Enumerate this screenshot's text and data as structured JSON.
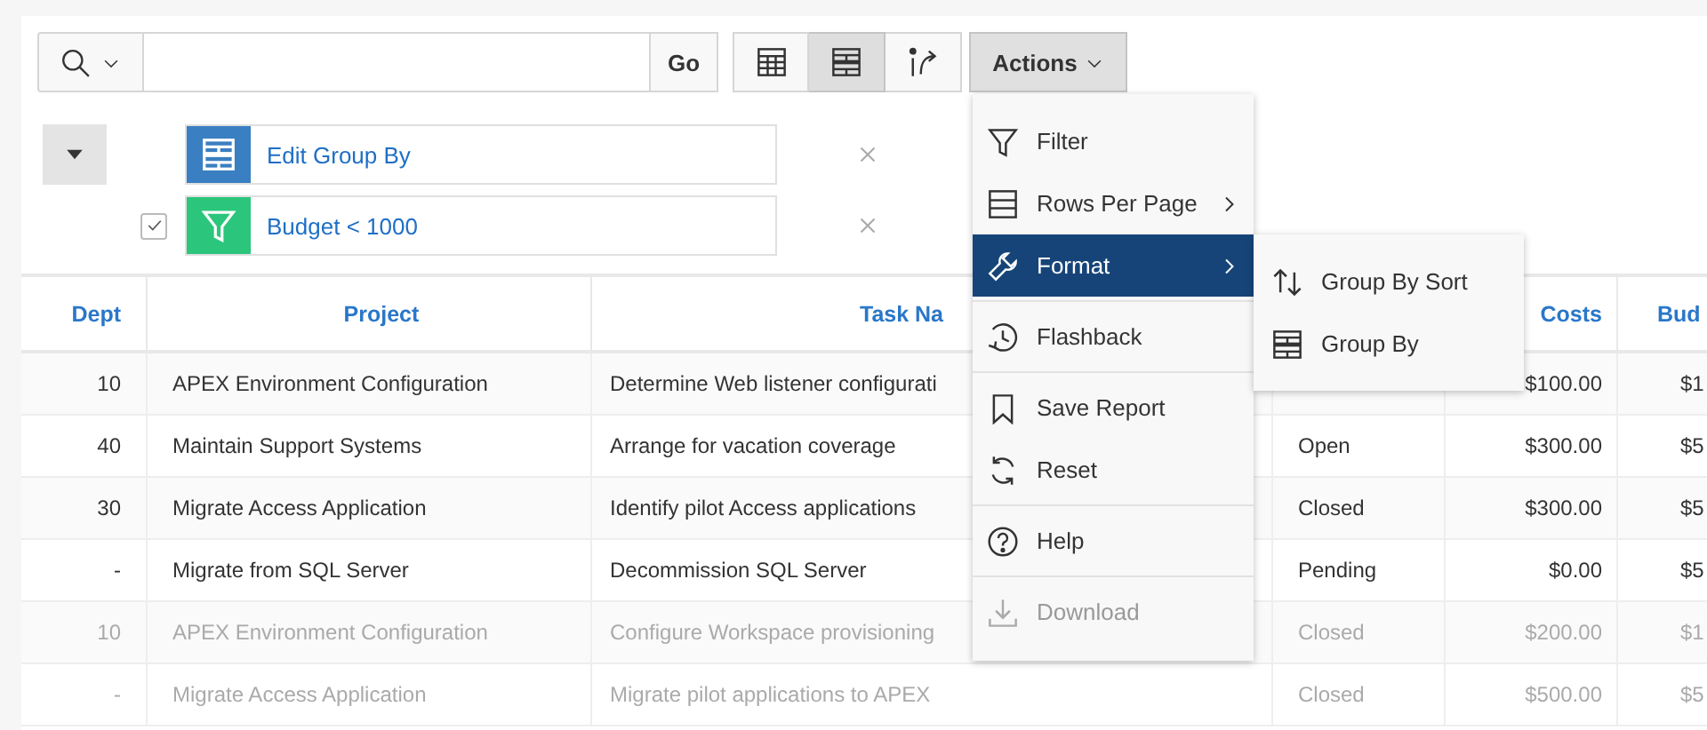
{
  "toolbar": {
    "go_button": "Go",
    "views": [
      {
        "selected": false
      },
      {
        "selected": true
      },
      {
        "selected": false
      }
    ],
    "actions_button": {
      "label": "Actions",
      "expanded": true
    }
  },
  "report_settings": {
    "expanded": true,
    "items": [
      {
        "kind": "group_by",
        "label": "Edit Group By"
      },
      {
        "kind": "filter",
        "label": "Budget < 1000",
        "checked": true
      }
    ]
  },
  "table": {
    "columns": [
      {
        "label": "Dept"
      },
      {
        "label": "Project"
      },
      {
        "label": "Task Na"
      },
      {},
      {
        "label": "Costs"
      },
      {
        "label": "Bud"
      }
    ],
    "rows": [
      {
        "faded": false,
        "cells": [
          "10",
          "APEX Environment Configuration",
          "Determine Web listener configurati",
          null,
          "$100.00",
          "$1"
        ]
      },
      {
        "faded": false,
        "cells": [
          "40",
          "Maintain Support Systems",
          "Arrange for vacation coverage",
          "Open",
          "$300.00",
          "$5"
        ]
      },
      {
        "faded": false,
        "cells": [
          "30",
          "Migrate Access Application",
          "Identify pilot Access applications",
          "Closed",
          "$300.00",
          "$5"
        ]
      },
      {
        "faded": false,
        "cells": [
          "-",
          "Migrate from SQL Server",
          "Decommission SQL Server",
          "Pending",
          "$0.00",
          "$5"
        ]
      },
      {
        "faded": true,
        "cells": [
          "10",
          "APEX Environment Configuration",
          "Configure Workspace provisioning",
          "Closed",
          "$200.00",
          "$1"
        ]
      },
      {
        "faded": true,
        "cells": [
          "-",
          "Migrate Access Application",
          "Migrate pilot applications to APEX",
          "Closed",
          "$500.00",
          "$5"
        ]
      }
    ]
  },
  "actions_menu": {
    "groups": [
      {
        "items": [
          {
            "label": "Filter",
            "submenu": false,
            "selected": false,
            "disabled": false
          },
          {
            "label": "Rows Per Page",
            "submenu": true,
            "selected": false,
            "disabled": false
          },
          {
            "label": "Format",
            "submenu": true,
            "selected": true,
            "disabled": false
          }
        ]
      },
      {
        "items": [
          {
            "label": "Flashback",
            "submenu": false,
            "selected": false,
            "disabled": false
          }
        ]
      },
      {
        "items": [
          {
            "label": "Save Report",
            "submenu": false,
            "selected": false,
            "disabled": false
          },
          {
            "label": "Reset",
            "submenu": false,
            "selected": false,
            "disabled": false
          }
        ]
      },
      {
        "items": [
          {
            "label": "Help",
            "submenu": false,
            "selected": false,
            "disabled": false
          }
        ]
      },
      {
        "items": [
          {
            "label": "Download",
            "submenu": false,
            "selected": false,
            "disabled": true
          }
        ]
      }
    ],
    "submenu": {
      "items": [
        {
          "label": "Group By Sort"
        },
        {
          "label": "Group By"
        }
      ]
    }
  }
}
